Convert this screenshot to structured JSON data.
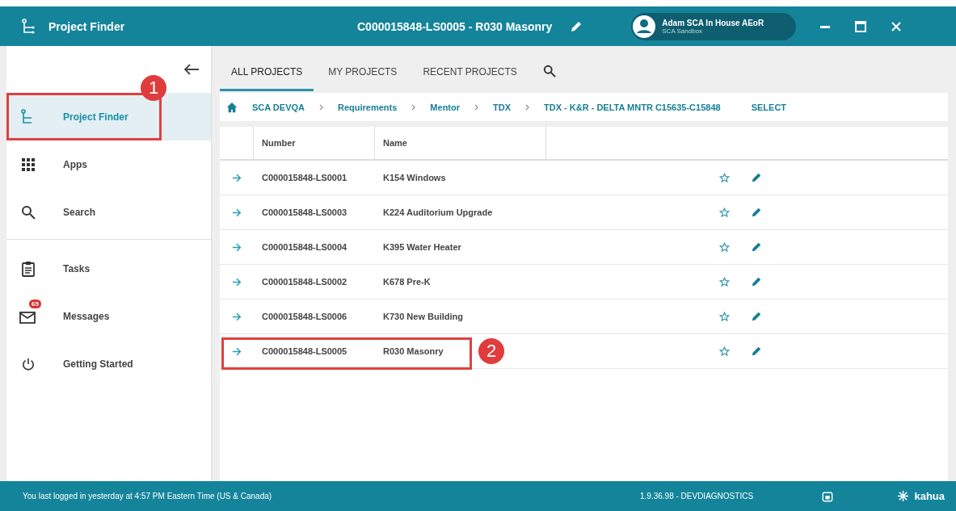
{
  "window": {
    "app_title": "Project Finder",
    "project_title": "C000015848-LS0005 - R030 Masonry",
    "user": {
      "name": "Adam SCA In House AEoR",
      "org": "SCA Sandbox"
    }
  },
  "sidebar": {
    "sections": [
      [
        {
          "kind": "finder",
          "label": "Project Finder",
          "selected": true,
          "callout": "1"
        },
        {
          "kind": "apps",
          "label": "Apps",
          "selected": false
        },
        {
          "kind": "search",
          "label": "Search",
          "selected": false
        }
      ],
      [
        {
          "kind": "tasks",
          "label": "Tasks",
          "selected": false
        },
        {
          "kind": "messages",
          "label": "Messages",
          "selected": false,
          "badge": "65"
        },
        {
          "kind": "power",
          "label": "Getting Started",
          "selected": false
        }
      ]
    ]
  },
  "tabs": [
    {
      "label": "ALL PROJECTS",
      "selected": true
    },
    {
      "label": "MY PROJECTS",
      "selected": false
    },
    {
      "label": "RECENT PROJECTS",
      "selected": false
    }
  ],
  "breadcrumb": {
    "items": [
      "SCA DEVQA",
      "Requirements",
      "Mentor",
      "TDX",
      "TDX - K&R - DELTA MNTR C15635-C15848"
    ],
    "action": "SELECT"
  },
  "table": {
    "columns": [
      "Number",
      "Name"
    ],
    "rows": [
      {
        "number": "C000015848-LS0001",
        "name": "K154 Windows"
      },
      {
        "number": "C000015848-LS0003",
        "name": "K224 Auditorium Upgrade"
      },
      {
        "number": "C000015848-LS0004",
        "name": "K395 Water Heater"
      },
      {
        "number": "C000015848-LS0002",
        "name": "K678 Pre-K"
      },
      {
        "number": "C000015848-LS0006",
        "name": "K730 New Building"
      },
      {
        "number": "C000015848-LS0005",
        "name": "R030 Masonry",
        "callout": "2"
      }
    ]
  },
  "status_bar": {
    "message": "You last logged in yesterday at 4:57 PM Eastern Time (US & Canada)",
    "version": "1.9.36.98 - DEVDIAGNOSTICS",
    "brand": "kahua"
  }
}
